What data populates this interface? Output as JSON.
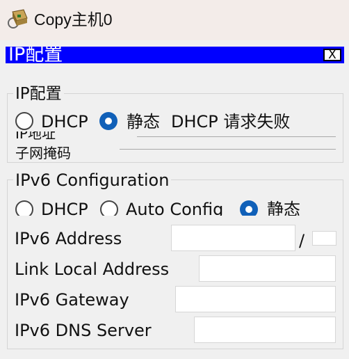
{
  "window": {
    "title": "Copy主机0",
    "icon": "packet-tracer-pc-icon"
  },
  "panel": {
    "title": "IP配置",
    "close_label": "X",
    "header_color": "#0000ff"
  },
  "ipv4": {
    "group_title": "IP配置",
    "dhcp_label": "DHCP",
    "static_label": "静态",
    "status_text": "DHCP 请求失败",
    "selected_mode": "static",
    "partial_label_1": "IP地址",
    "partial_label_2": "子网掩码"
  },
  "ipv6": {
    "group_title": "IPv6 Configuration",
    "dhcp_label": "DHCP",
    "auto_label": "Auto Config",
    "static_label": "静态",
    "selected_mode": "static",
    "address_label": "IPv6 Address",
    "address_value": "",
    "prefix_separator": "/",
    "prefix_value": "",
    "link_local_label": "Link Local Address",
    "link_local_value": "",
    "gateway_label": "IPv6 Gateway",
    "gateway_value": "",
    "dns_label": "IPv6 DNS Server",
    "dns_value": ""
  },
  "colors": {
    "accent": "#1060b8"
  }
}
